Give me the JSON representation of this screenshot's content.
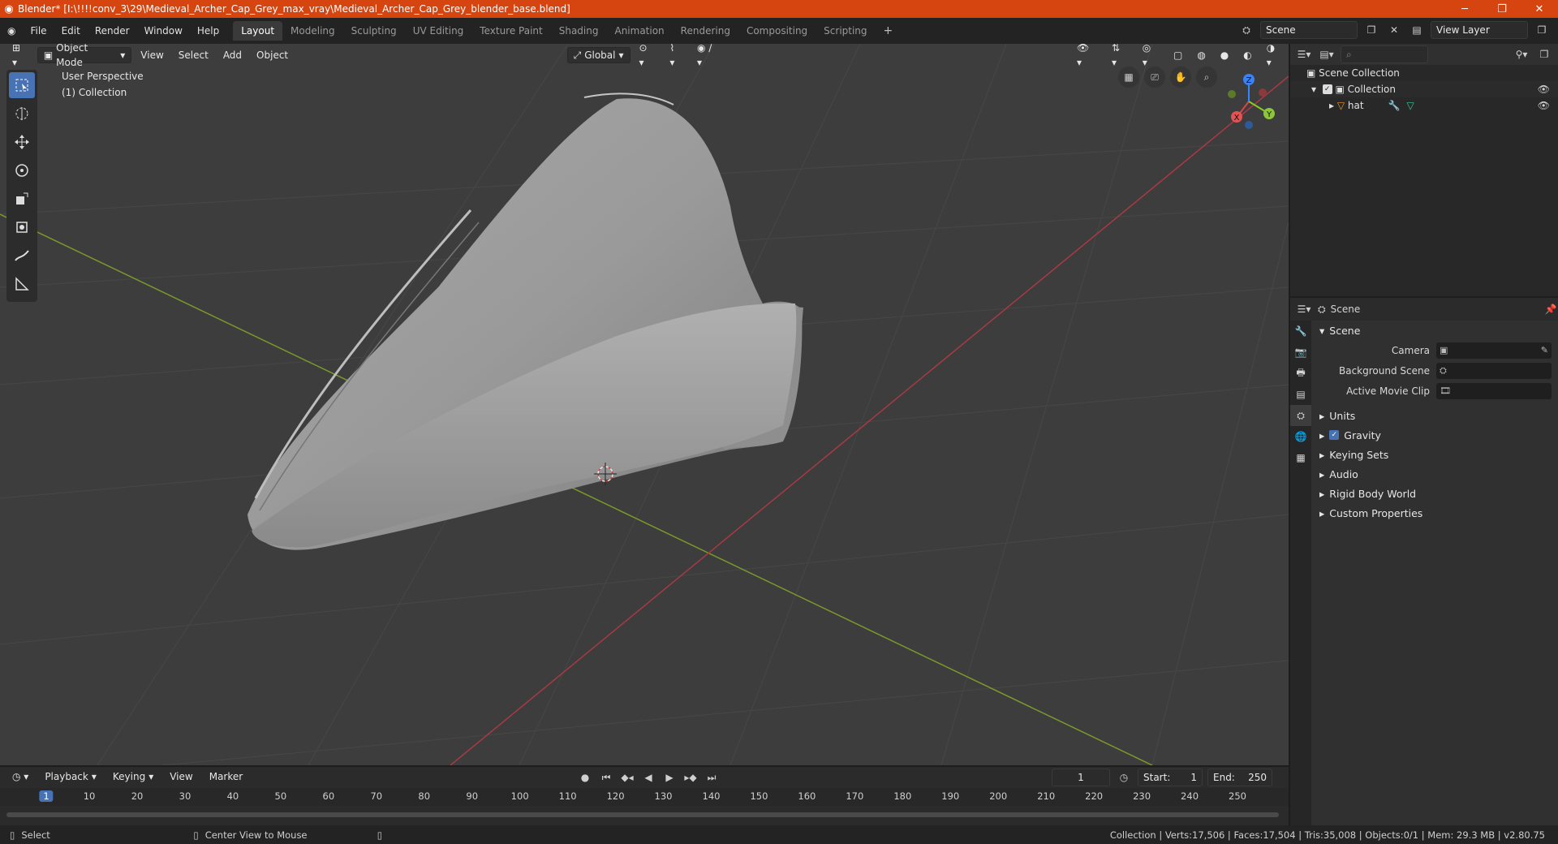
{
  "window": {
    "title": "Blender* [I:\\!!!!conv_3\\29\\Medieval_Archer_Cap_Grey_max_vray\\Medieval_Archer_Cap_Grey_blender_base.blend]"
  },
  "menu": [
    "File",
    "Edit",
    "Render",
    "Window",
    "Help"
  ],
  "workspaces": [
    "Layout",
    "Modeling",
    "Sculpting",
    "UV Editing",
    "Texture Paint",
    "Shading",
    "Animation",
    "Rendering",
    "Compositing",
    "Scripting"
  ],
  "scene_field": "Scene",
  "view_layer_field": "View Layer",
  "viewport": {
    "mode": "Object Mode",
    "header_menus": [
      "View",
      "Select",
      "Add",
      "Object"
    ],
    "orientation": "Global",
    "perspective": "User Perspective",
    "collection": "(1) Collection",
    "gizmo": {
      "z": "Z",
      "y": "Y",
      "x": "X"
    }
  },
  "outliner": {
    "root": "Scene Collection",
    "collection": "Collection",
    "object": "hat"
  },
  "properties": {
    "header": "Scene",
    "section": "Scene",
    "fields": [
      {
        "label": "Camera"
      },
      {
        "label": "Background Scene"
      },
      {
        "label": "Active Movie Clip"
      }
    ],
    "panels": [
      "Units",
      "Gravity",
      "Keying Sets",
      "Audio",
      "Rigid Body World",
      "Custom Properties"
    ]
  },
  "timeline": {
    "menus": [
      "Playback",
      "Keying",
      "View",
      "Marker"
    ],
    "current_frame": "1",
    "start_label": "Start:",
    "start": "1",
    "end_label": "End:",
    "end": "250",
    "ticks": [
      "1",
      "10",
      "20",
      "30",
      "40",
      "50",
      "60",
      "70",
      "80",
      "90",
      "100",
      "110",
      "120",
      "130",
      "140",
      "150",
      "160",
      "170",
      "180",
      "190",
      "200",
      "210",
      "220",
      "230",
      "240",
      "250"
    ]
  },
  "status": {
    "left": "Select",
    "middle": "Center View to Mouse",
    "right": "Collection | Verts:17,506 | Faces:17,504 | Tris:35,008 | Objects:0/1 | Mem: 29.3 MB | v2.80.75"
  },
  "colors": {
    "accent": "#4772b3",
    "title_bar": "#d64510",
    "axis_x": "#a63a45",
    "axis_y": "#7a9a2a"
  }
}
